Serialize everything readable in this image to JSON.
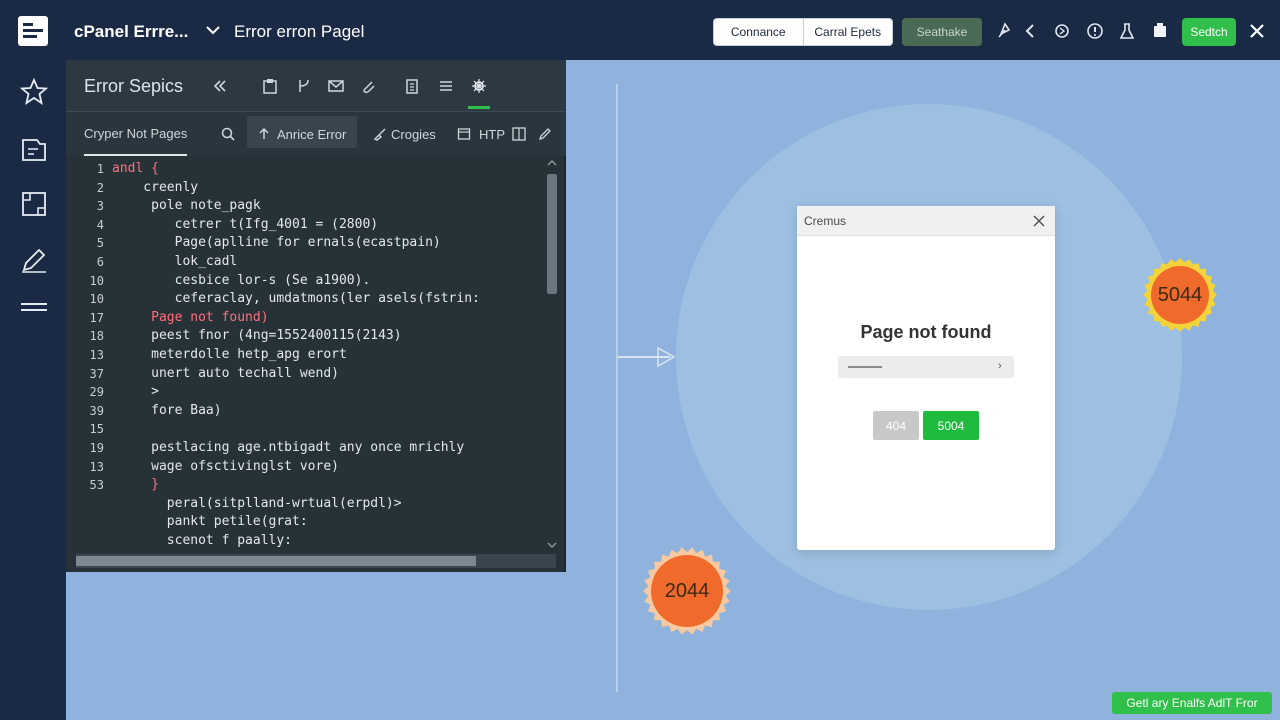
{
  "header": {
    "app_title": "cPanel Errre...",
    "page_title": "Error erron Pagel",
    "segment_left": "Connance",
    "segment_right": "Carral Epets",
    "gray_button": "Seathake",
    "green_button": "Sedtch"
  },
  "editor": {
    "title": "Error Sepics",
    "tabs": [
      "Cryper Not Pages",
      "Anrice Error",
      "Crogies",
      "HTP"
    ],
    "line_numbers": [
      "1",
      "2",
      "3",
      "4",
      "5",
      "6",
      "10",
      "10",
      "17",
      "18",
      "13",
      "37",
      "29",
      "39",
      "15",
      "19",
      "13",
      "53"
    ],
    "lines": [
      {
        "text": "andl {",
        "red": true
      },
      {
        "text": "    creenly",
        "red": false
      },
      {
        "text": "     pole note_pagk",
        "red": false
      },
      {
        "text": "        cetrer t(Ifg_4001 = (2800)",
        "red": false
      },
      {
        "text": "        Page(aplline for ernals(ecastpain)",
        "red": false
      },
      {
        "text": "        lok_cadl",
        "red": false
      },
      {
        "text": "        cesbice lor-s (Se a1900).",
        "red": false
      },
      {
        "text": "        ceferaclay, umdatmons(ler asels(fstrin:",
        "red": false
      },
      {
        "text": "     Page not found)",
        "red": true
      },
      {
        "text": "     peest fnor (4ng=1552400115(2143)",
        "red": false
      },
      {
        "text": "     meterdolle hetp_apg erort",
        "red": false
      },
      {
        "text": "     unert auto techall wend)",
        "red": false
      },
      {
        "text": "     >",
        "red": false
      },
      {
        "text": "     fore Baa)",
        "red": false
      },
      {
        "text": "",
        "red": false
      },
      {
        "text": "     pestlacing age.ntbigadt any once mrichly",
        "red": false
      },
      {
        "text": "     wage ofsctivinglst vore)",
        "red": false
      },
      {
        "text": "     }",
        "red": true
      },
      {
        "text": "       peral(sitplland-wrtual(erpdl)>",
        "red": false
      },
      {
        "text": "       pankt petile(grat:",
        "red": false
      },
      {
        "text": "       scenot f paally:",
        "red": false
      }
    ]
  },
  "dialog": {
    "title": "Cremus",
    "heading": "Page not found",
    "btn_404": "404",
    "btn_5004": "5004"
  },
  "badges": {
    "right": "5044",
    "bottom": "2044"
  },
  "footer_button": "Getl ary Enalfs AdlT Fror",
  "colors": {
    "header_bg": "#1a2a45",
    "accent_green": "#2fbf4a",
    "canvas_bg": "#8fb3dc",
    "badge_orange": "#f06a2c",
    "badge_yellow": "#f3d23a",
    "code_red": "#ff6f7d"
  }
}
